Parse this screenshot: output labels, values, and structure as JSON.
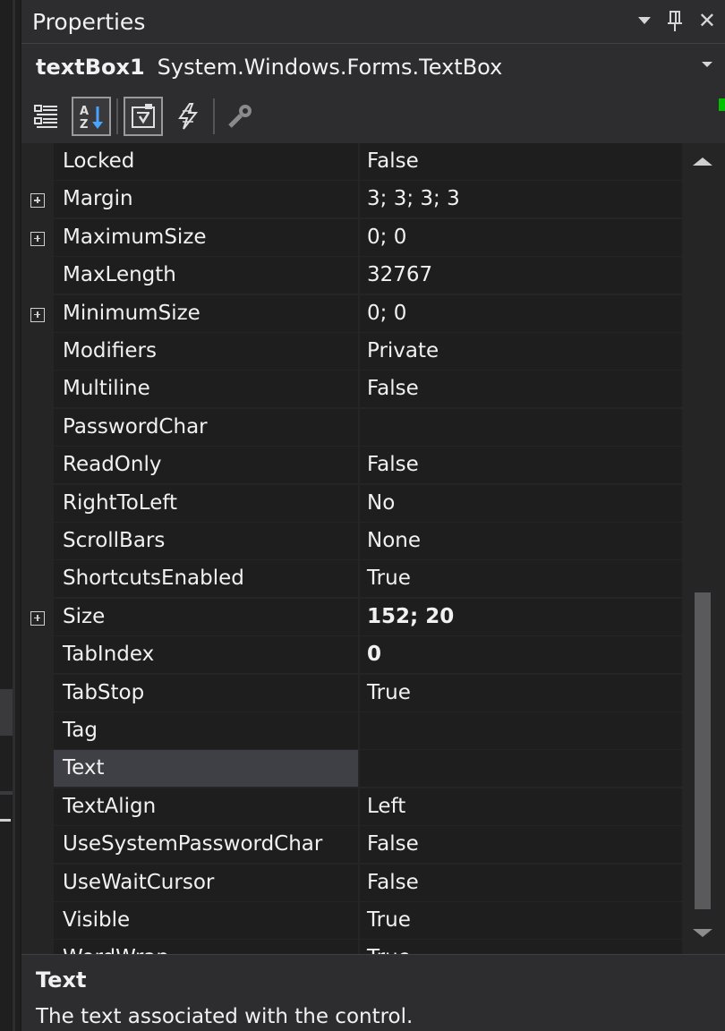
{
  "window": {
    "title": "Properties",
    "controls": {
      "dropdown_icon": "chevron-down-icon",
      "pin_icon": "pin-icon",
      "close_label": "✕"
    }
  },
  "object_selector": {
    "name": "textBox1",
    "type": "System.Windows.Forms.TextBox"
  },
  "toolbar": {
    "buttons": [
      {
        "icon": "categorized-icon",
        "active": false
      },
      {
        "icon": "alphabetical-icon",
        "active": true
      },
      {
        "icon": "properties-icon",
        "active": true
      },
      {
        "icon": "events-icon",
        "active": false
      },
      {
        "icon": "property-pages-icon",
        "active": false
      }
    ]
  },
  "properties": [
    {
      "name": "Locked",
      "value": "False",
      "expandable": false,
      "bold": false
    },
    {
      "name": "Margin",
      "value": "3; 3; 3; 3",
      "expandable": true,
      "bold": false
    },
    {
      "name": "MaximumSize",
      "value": "0; 0",
      "expandable": true,
      "bold": false
    },
    {
      "name": "MaxLength",
      "value": "32767",
      "expandable": false,
      "bold": false
    },
    {
      "name": "MinimumSize",
      "value": "0; 0",
      "expandable": true,
      "bold": false
    },
    {
      "name": "Modifiers",
      "value": "Private",
      "expandable": false,
      "bold": false
    },
    {
      "name": "Multiline",
      "value": "False",
      "expandable": false,
      "bold": false
    },
    {
      "name": "PasswordChar",
      "value": "",
      "expandable": false,
      "bold": false
    },
    {
      "name": "ReadOnly",
      "value": "False",
      "expandable": false,
      "bold": false
    },
    {
      "name": "RightToLeft",
      "value": "No",
      "expandable": false,
      "bold": false
    },
    {
      "name": "ScrollBars",
      "value": "None",
      "expandable": false,
      "bold": false
    },
    {
      "name": "ShortcutsEnabled",
      "value": "True",
      "expandable": false,
      "bold": false
    },
    {
      "name": "Size",
      "value": "152; 20",
      "expandable": true,
      "bold": true
    },
    {
      "name": "TabIndex",
      "value": "0",
      "expandable": false,
      "bold": true
    },
    {
      "name": "TabStop",
      "value": "True",
      "expandable": false,
      "bold": false
    },
    {
      "name": "Tag",
      "value": "",
      "expandable": false,
      "bold": false
    },
    {
      "name": "Text",
      "value": "",
      "expandable": false,
      "bold": false,
      "selected": true
    },
    {
      "name": "TextAlign",
      "value": "Left",
      "expandable": false,
      "bold": false
    },
    {
      "name": "UseSystemPasswordChar",
      "value": "False",
      "expandable": false,
      "bold": false
    },
    {
      "name": "UseWaitCursor",
      "value": "False",
      "expandable": false,
      "bold": false
    },
    {
      "name": "Visible",
      "value": "True",
      "expandable": false,
      "bold": false
    },
    {
      "name": "WordWrap",
      "value": "True",
      "expandable": false,
      "bold": false
    }
  ],
  "description": {
    "title": "Text",
    "text": "The text associated with the control."
  },
  "colors": {
    "panel_bg": "#252526",
    "cell_bg": "#1e1e1e",
    "selected_bg": "#3f3f46",
    "text": "#f1f1f1",
    "status_green": "#00c000"
  }
}
